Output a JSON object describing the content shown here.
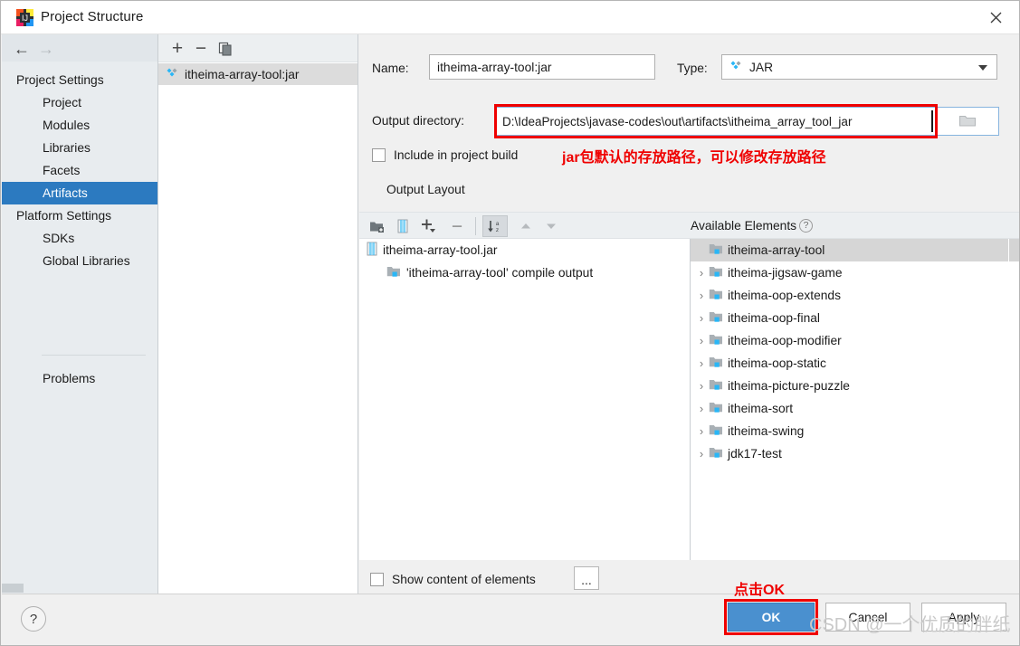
{
  "window": {
    "title": "Project Structure",
    "app_icon": "intellij-idea-icon",
    "close_label": "✕"
  },
  "nav": {
    "back_icon": "←",
    "forward_icon": "→"
  },
  "sidebar": {
    "groups": [
      {
        "label": "Project Settings",
        "items": [
          {
            "label": "Project",
            "selected": false
          },
          {
            "label": "Modules",
            "selected": false
          },
          {
            "label": "Libraries",
            "selected": false
          },
          {
            "label": "Facets",
            "selected": false
          },
          {
            "label": "Artifacts",
            "selected": true
          }
        ]
      },
      {
        "label": "Platform Settings",
        "items": [
          {
            "label": "SDKs",
            "selected": false
          },
          {
            "label": "Global Libraries",
            "selected": false
          }
        ]
      }
    ],
    "problems_label": "Problems"
  },
  "artifacts_panel": {
    "toolbar": {
      "add_label": "+",
      "remove_label": "−",
      "copy_icon": "copy-icon"
    },
    "items": [
      {
        "label": "itheima-array-tool:jar",
        "icon": "artifact-jar-icon",
        "selected": true
      }
    ]
  },
  "form": {
    "name_label": "Name:",
    "name_value": "itheima-array-tool:jar",
    "type_label": "Type:",
    "type_value": "JAR",
    "type_icon": "artifact-jar-icon",
    "output_dir_label": "Output directory:",
    "output_dir_value": "D:\\IdeaProjects\\javase-codes\\out\\artifacts\\itheima_array_tool_jar",
    "browse_icon": "folder-icon",
    "include_in_build_label": "Include in project build",
    "include_in_build_checked": false,
    "output_layout_label": "Output Layout"
  },
  "annotations": {
    "path_note": "jar包默认的存放路径，可以修改存放路径",
    "ok_note": "点击OK",
    "highlight_color": "#ef0000"
  },
  "layout_toolbar": {
    "buttons": [
      {
        "icon": "add-folder-icon",
        "name": "add-directory-button",
        "active": false
      },
      {
        "icon": "archive-icon",
        "name": "create-archive-button",
        "active": false
      },
      {
        "icon": "plus-dropdown-icon",
        "name": "add-copy-of-button",
        "active": false
      },
      {
        "icon": "minus-icon",
        "name": "remove-element-button",
        "active": false
      },
      {
        "icon": "sort-az-icon",
        "name": "sort-button",
        "active": true
      },
      {
        "icon": "arrow-up-icon",
        "name": "move-up-button",
        "active": false
      },
      {
        "icon": "arrow-down-icon",
        "name": "move-down-button",
        "active": false
      }
    ]
  },
  "output_layout_tree": {
    "rows": [
      {
        "label": "itheima-array-tool.jar",
        "icon": "archive-icon",
        "indent": 0
      },
      {
        "label": "'itheima-array-tool' compile output",
        "icon": "module-output-icon",
        "indent": 1
      }
    ]
  },
  "available_elements": {
    "title": "Available Elements",
    "help_label": "?",
    "rows": [
      {
        "label": "itheima-array-tool",
        "expandable": false,
        "selected": true
      },
      {
        "label": "itheima-jigsaw-game",
        "expandable": true,
        "selected": false
      },
      {
        "label": "itheima-oop-extends",
        "expandable": true,
        "selected": false
      },
      {
        "label": "itheima-oop-final",
        "expandable": true,
        "selected": false
      },
      {
        "label": "itheima-oop-modifier",
        "expandable": true,
        "selected": false
      },
      {
        "label": "itheima-oop-static",
        "expandable": true,
        "selected": false
      },
      {
        "label": "itheima-picture-puzzle",
        "expandable": true,
        "selected": false
      },
      {
        "label": "itheima-sort",
        "expandable": true,
        "selected": false
      },
      {
        "label": "itheima-swing",
        "expandable": true,
        "selected": false
      },
      {
        "label": "jdk17-test",
        "expandable": true,
        "selected": false
      }
    ]
  },
  "bottom": {
    "show_content_label": "Show content of elements",
    "show_content_checked": false,
    "ellipsis_label": "..."
  },
  "footer": {
    "help_label": "?",
    "ok_label": "OK",
    "cancel_label": "Cancel",
    "apply_label": "Apply"
  },
  "watermark": "CSDN @一个优质的胖纸",
  "colors": {
    "selection_blue": "#2c7ac0",
    "ok_button_blue": "#4a90cf",
    "annotation_red": "#ef0000",
    "sidebar_bg": "#e8ecef"
  }
}
